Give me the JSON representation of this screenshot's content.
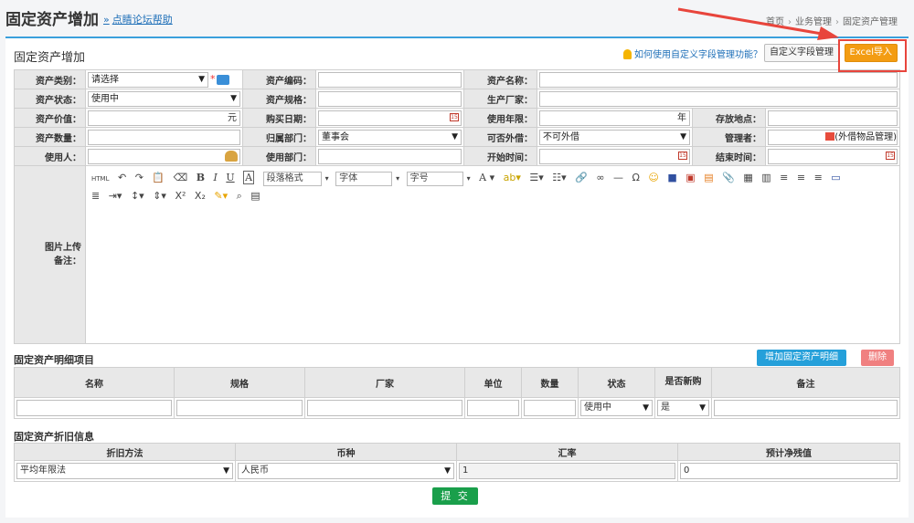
{
  "header": {
    "title": "固定资产增加",
    "help_prefix": "»",
    "help_link": "点睛论坛帮助",
    "breadcrumb": [
      "首页",
      "业务管理",
      "固定资产管理"
    ]
  },
  "card": {
    "title": "固定资产增加",
    "tip": "如何使用自定义字段管理功能？",
    "custom_field_button": "自定义字段管理",
    "excel_button": "Excel导入"
  },
  "form": {
    "asset_category": {
      "label": "资产类别：",
      "value": "请选择"
    },
    "asset_code": {
      "label": "资产编码：",
      "value": ""
    },
    "asset_name": {
      "label": "资产名称：",
      "value": ""
    },
    "asset_status": {
      "label": "资产状态：",
      "value": "使用中"
    },
    "asset_spec": {
      "label": "资产规格：",
      "value": ""
    },
    "manufacturer": {
      "label": "生产厂家：",
      "value": ""
    },
    "asset_value": {
      "label": "资产价值：",
      "value": "",
      "unit": "元"
    },
    "purchase_date": {
      "label": "购买日期：",
      "value": ""
    },
    "service_life": {
      "label": "使用年限：",
      "value": "",
      "unit": "年"
    },
    "storage_location": {
      "label": "存放地点：",
      "value": ""
    },
    "asset_quantity": {
      "label": "资产数量：",
      "value": ""
    },
    "owner_department": {
      "label": "归属部门：",
      "value": "董事会"
    },
    "lendable": {
      "label": "可否外借：",
      "value": "不可外借"
    },
    "manager": {
      "label": "管理者：",
      "value": "",
      "note": "(外借物品管理)"
    },
    "user": {
      "label": "使用人：",
      "value": ""
    },
    "use_department": {
      "label": "使用部门：",
      "value": ""
    },
    "start_time": {
      "label": "开始时间：",
      "value": ""
    },
    "end_time": {
      "label": "结束时间：",
      "value": ""
    },
    "image_remark_label_1": "图片上传",
    "image_remark_label_2": "备注："
  },
  "editor": {
    "paragraph_format": "段落格式",
    "font": "字体",
    "font_size": "字号"
  },
  "details": {
    "title": "固定资产明细项目",
    "add_button": "增加固定资产明细",
    "delete_button": "删除",
    "columns": [
      "名称",
      "规格",
      "厂家",
      "单位",
      "数量",
      "状态",
      "是否新购",
      "备注"
    ],
    "row": {
      "status": "使用中",
      "is_new": "是"
    }
  },
  "depreciation": {
    "title": "固定资产折旧信息",
    "columns": [
      "折旧方法",
      "币种",
      "汇率",
      "预计净残值"
    ],
    "method": "平均年限法",
    "currency": "人民币",
    "exchange_rate": "1",
    "residual_value": "0"
  },
  "submit_button": "提 交",
  "colors": {
    "accent": "#3aa0dc",
    "excel": "#f39c12",
    "submit": "#1a9f4b",
    "annotation": "#e8453c"
  }
}
